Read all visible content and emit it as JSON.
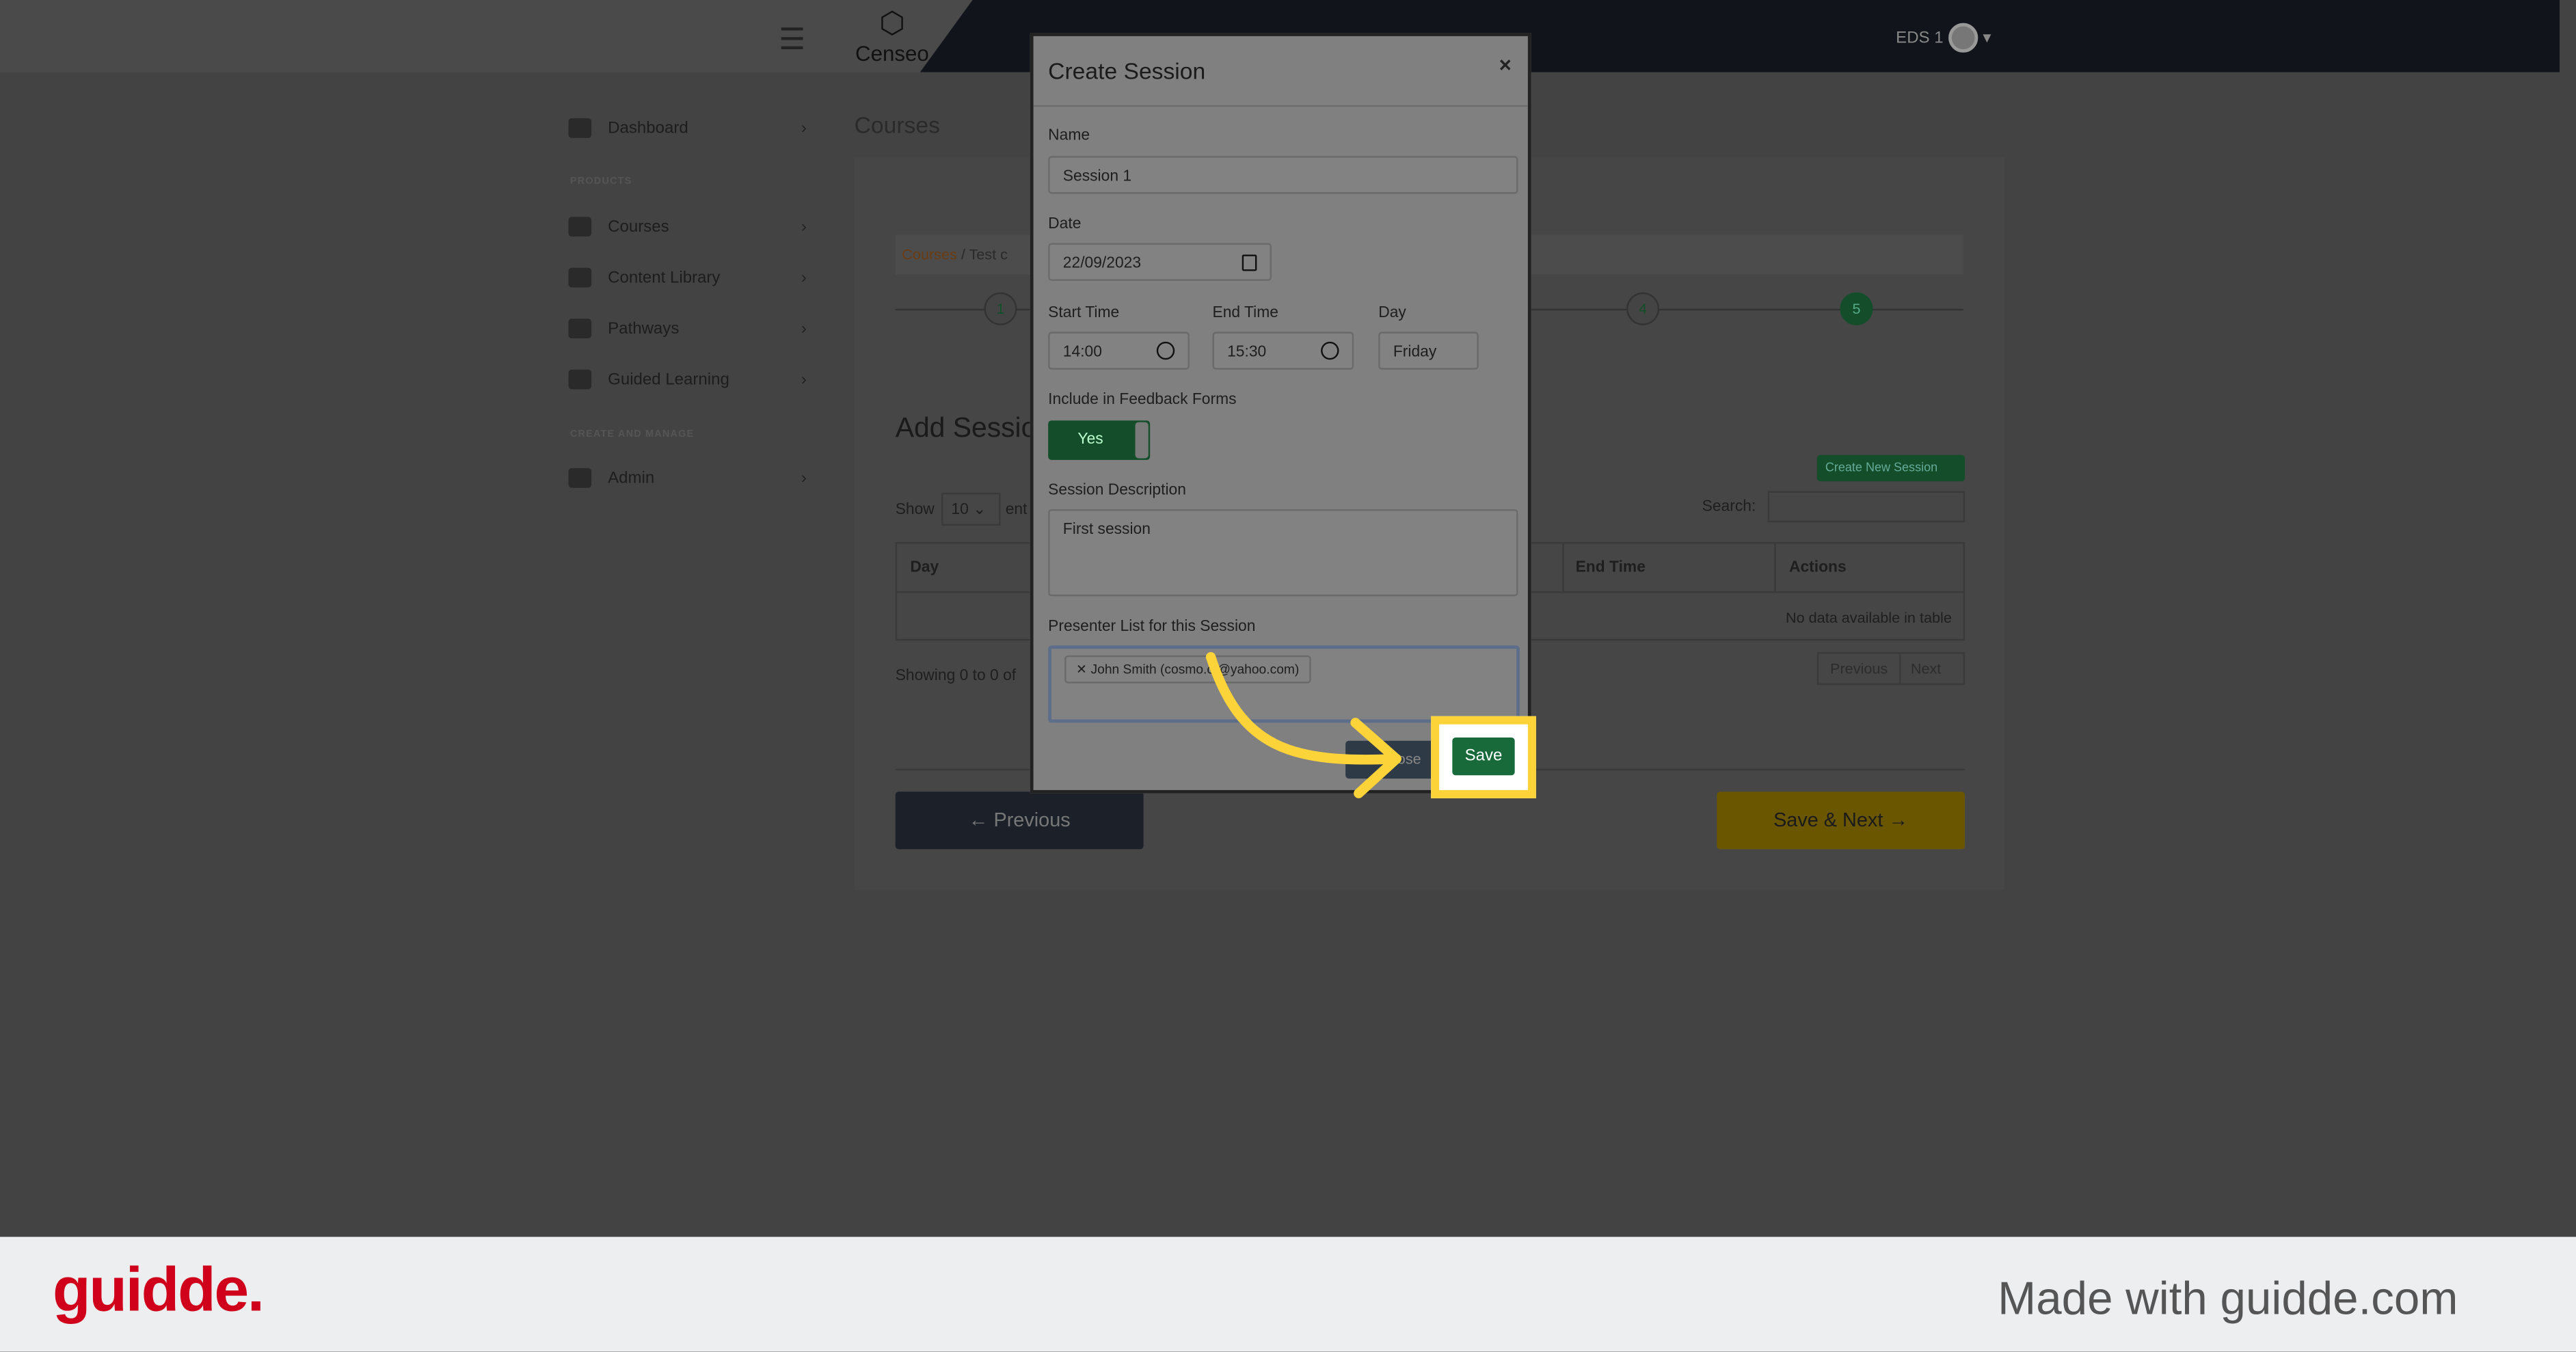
{
  "header": {
    "logo": "Censeo",
    "user": "EDS 1"
  },
  "sidebar": {
    "items": [
      {
        "label": "Dashboard"
      },
      {
        "label": "Courses"
      },
      {
        "label": "Content Library"
      },
      {
        "label": "Pathways"
      },
      {
        "label": "Guided Learning"
      },
      {
        "label": "Admin"
      }
    ],
    "sections": [
      "PRODUCTS",
      "CREATE AND MANAGE"
    ]
  },
  "page": {
    "title": "Courses",
    "breadcrumb": [
      "Courses",
      "Test c"
    ],
    "steps": [
      "1",
      "4",
      "5"
    ],
    "section_title": "Add Sessio",
    "show_label": "Show",
    "show_value": "10",
    "entries_suffix": "ent",
    "search_label": "Search:",
    "create_button": "Create New Session",
    "columns": [
      "Day",
      "End Time",
      "Actions"
    ],
    "empty": "No data available in table",
    "showing": "Showing 0 to 0 of",
    "pager": [
      "Previous",
      "Next"
    ],
    "prev_button": "Previous",
    "next_button": "Save & Next"
  },
  "modal": {
    "title": "Create Session",
    "close_icon": "×",
    "name_label": "Name",
    "name_value": "Session 1",
    "date_label": "Date",
    "date_value": "22/09/2023",
    "start_label": "Start Time",
    "start_value": "14:00",
    "end_label": "End Time",
    "end_value": "15:30",
    "day_label": "Day",
    "day_value": "Friday",
    "feedback_label": "Include in Feedback Forms",
    "feedback_value": "Yes",
    "desc_label": "Session Description",
    "desc_value": "First session",
    "presenter_label": "Presenter List for this Session",
    "presenter_tag": "John Smith (cosmo.ct@yahoo.com)",
    "close_button": "Close",
    "save_button": "Save"
  },
  "footer": {
    "brand": "guidde.",
    "made_with": "Made with guidde.com"
  },
  "colors": {
    "highlight": "#fdd33a",
    "green": "#134d2a",
    "brand": "#d0021b"
  }
}
